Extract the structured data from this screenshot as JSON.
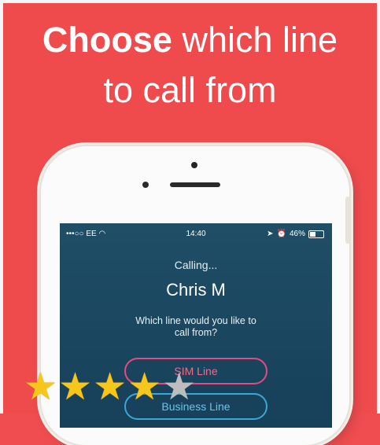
{
  "header": {
    "line1_bold": "Choose",
    "line1_rest": "which line",
    "line2": "to call from"
  },
  "status_bar": {
    "carrier": "•••○○ EE",
    "time": "14:40",
    "battery": "46%"
  },
  "call": {
    "status": "Calling...",
    "contact_name": "Chris M",
    "prompt_line1": "Which line would you like to",
    "prompt_line2": "call from?"
  },
  "options": {
    "sim_line": "SIM Line",
    "business_line": "Business Line"
  },
  "rating": {
    "value": 4,
    "max": 5
  },
  "colors": {
    "background": "#ef4b4d",
    "screen": "#1b4861",
    "sim_accent": "#e64a82",
    "business_accent": "#3aa7d4",
    "star": "#f7c61a"
  }
}
